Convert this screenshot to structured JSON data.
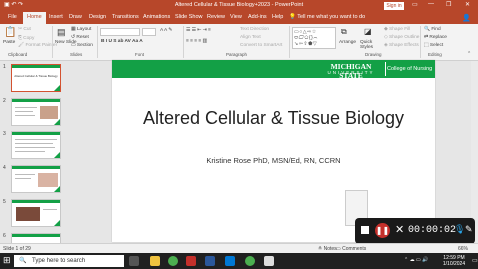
{
  "window": {
    "title": "Altered Cellular & Tissue Biology+2023 - PowerPoint",
    "sign_in": "Sign in"
  },
  "tabs": [
    "File",
    "Home",
    "Insert",
    "Draw",
    "Design",
    "Transitions",
    "Animations",
    "Slide Show",
    "Review",
    "View",
    "Add-ins",
    "Help"
  ],
  "tell_me": "Tell me what you want to do",
  "ribbon": {
    "paste": "Paste",
    "cut": "Cut",
    "copy": "Copy",
    "format_painter": "Format Painter",
    "new_slide": "New Slide",
    "layout": "Layout",
    "reset": "Reset",
    "section": "Section",
    "groups": [
      "Clipboard",
      "Slides",
      "Font",
      "Paragraph",
      "Drawing",
      "Editing"
    ],
    "arrange": "Arrange",
    "quick_styles": "Quick Styles",
    "shape_fill": "Shape Fill",
    "shape_outline": "Shape Outline",
    "shape_effects": "Shape Effects",
    "text_direction": "Text Direction",
    "align_text": "Align Text",
    "convert_smartart": "Convert to SmartArt",
    "find": "Find",
    "replace": "Replace",
    "select": "Select"
  },
  "thumbnails": {
    "numbers": [
      "1",
      "2",
      "3",
      "4",
      "5",
      "6"
    ],
    "first_title": "Altered Cellular & Tissue Biology"
  },
  "slide": {
    "logo_line1": "MICHIGAN STATE",
    "logo_line2": "UNIVERSITY",
    "college": "College of Nursing",
    "title": "Altered Cellular & Tissue Biology",
    "subtitle": "Kristine Rose PhD, MSN/Ed, RN, CCRN"
  },
  "recorder": {
    "time": "00:00:02"
  },
  "status": {
    "slide_count": "Slide 1 of 29",
    "notes": "Notes",
    "comments": "Comments",
    "zoom": "66%"
  },
  "taskbar": {
    "search_placeholder": "Type here to search",
    "time": "12:59 PM",
    "date": "1/10/2024"
  },
  "colors": {
    "ppt_red": "#b7472a",
    "msu_green": "#13a046"
  }
}
